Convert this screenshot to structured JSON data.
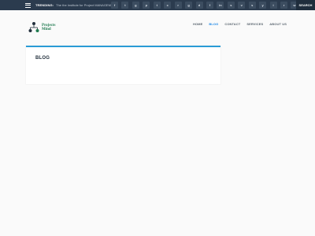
{
  "topbar": {
    "trending_label": "TRENDING:",
    "trending_text": "The the Institute for Project MANAGEMENT",
    "socials": [
      {
        "icon": "facebook-icon",
        "glyph": "f"
      },
      {
        "icon": "twitter-icon",
        "glyph": "t"
      },
      {
        "icon": "google-plus-icon",
        "glyph": "g"
      },
      {
        "icon": "pinterest-icon",
        "glyph": "p"
      },
      {
        "icon": "tumblr-icon",
        "glyph": "t"
      },
      {
        "icon": "cloud-icon",
        "glyph": "c"
      },
      {
        "icon": "rss-icon",
        "glyph": "r"
      },
      {
        "icon": "github-icon",
        "glyph": "g"
      },
      {
        "icon": "dribbble-icon",
        "glyph": "d"
      },
      {
        "icon": "flickr-icon",
        "glyph": "f"
      },
      {
        "icon": "linkedin-icon",
        "glyph": "in"
      },
      {
        "icon": "share-icon",
        "glyph": "s"
      },
      {
        "icon": "vimeo-icon",
        "glyph": "v"
      },
      {
        "icon": "skype-icon",
        "glyph": "s"
      },
      {
        "icon": "youtube-icon",
        "glyph": "y"
      },
      {
        "icon": "instagram-icon",
        "glyph": "i"
      },
      {
        "icon": "reddit-icon",
        "glyph": "r"
      },
      {
        "icon": "whatsapp-icon",
        "glyph": "w"
      },
      {
        "icon": "behance-icon",
        "glyph": "b"
      }
    ],
    "search_label": "SEARCH"
  },
  "logo": {
    "line1": "Projects",
    "line2": "Mind",
    "tagline": ""
  },
  "nav": {
    "items": [
      {
        "label": "HOME",
        "active": false
      },
      {
        "label": "BLOG",
        "active": true
      },
      {
        "label": "CONTACT",
        "active": false
      },
      {
        "label": "SERVICES",
        "active": false
      },
      {
        "label": "ABOUT US",
        "active": false
      }
    ]
  },
  "main": {
    "page_title": "BLOG"
  },
  "colors": {
    "topbar_bg": "#2b3b4e",
    "accent": "#1e88e5",
    "card_border": "#2a9bd6",
    "logo_green": "#1f7a4f"
  }
}
